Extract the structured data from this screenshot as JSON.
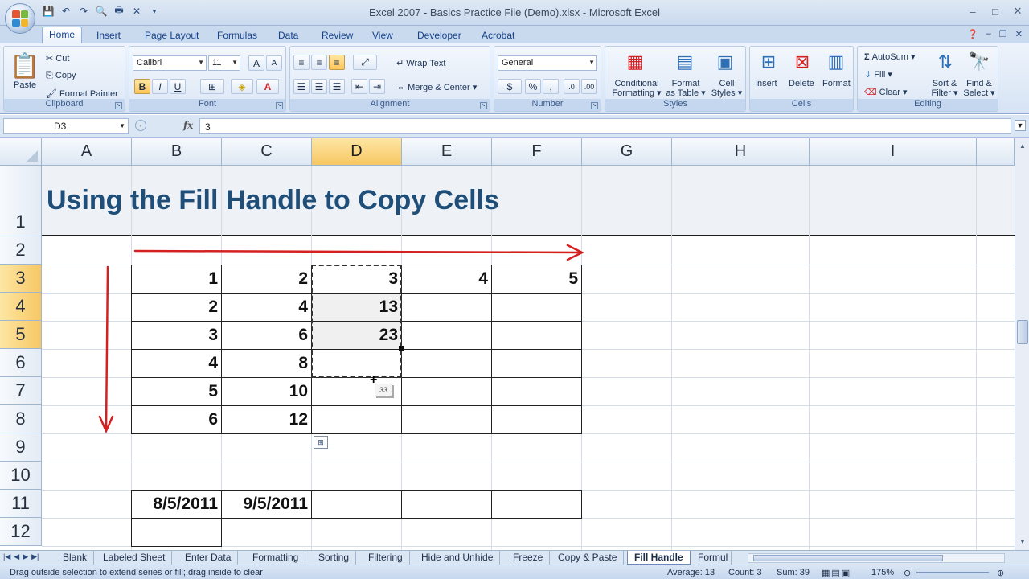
{
  "window": {
    "title": "Excel 2007 - Basics Practice File (Demo).xlsx - Microsoft Excel",
    "controls": [
      "–",
      "□",
      "✕"
    ]
  },
  "qat": [
    "save-icon",
    "undo-icon",
    "redo-icon",
    "print-preview-icon",
    "quick-print-icon",
    "close-icon"
  ],
  "ribbon_tabs": [
    "Home",
    "Insert",
    "Page Layout",
    "Formulas",
    "Data",
    "Review",
    "View",
    "Developer",
    "Acrobat"
  ],
  "ribbon": {
    "clipboard": {
      "label": "Clipboard",
      "paste": "Paste",
      "cut": "Cut",
      "copy": "Copy",
      "format_painter": "Format Painter"
    },
    "font": {
      "label": "Font",
      "font_name": "Calibri",
      "font_size": "11",
      "bold": "B",
      "italic": "I",
      "underline": "U"
    },
    "alignment": {
      "label": "Alignment",
      "wrap_text": "Wrap Text",
      "merge_center": "Merge & Center"
    },
    "number": {
      "label": "Number",
      "format": "General",
      "currency": "$",
      "percent": "%",
      "comma": ","
    },
    "styles": {
      "label": "Styles",
      "conditional": "Conditional",
      "conditional2": "Formatting",
      "format_table": "Format",
      "format_table2": "as Table",
      "cell_styles": "Cell",
      "cell_styles2": "Styles"
    },
    "cells": {
      "label": "Cells",
      "insert": "Insert",
      "delete": "Delete",
      "format": "Format"
    },
    "editing": {
      "label": "Editing",
      "autosum": "AutoSum",
      "fill": "Fill",
      "clear": "Clear",
      "sort": "Sort &",
      "sort2": "Filter",
      "find": "Find &",
      "find2": "Select"
    }
  },
  "formula_bar": {
    "name_box": "D3",
    "fx": "fx",
    "value": "3"
  },
  "columns": [
    "A",
    "B",
    "C",
    "D",
    "E",
    "F",
    "G",
    "H",
    "I"
  ],
  "rows": [
    "1",
    "2",
    "3",
    "4",
    "5",
    "6",
    "7",
    "8",
    "9",
    "10",
    "11",
    "12"
  ],
  "sheet": {
    "title": "Using the Fill Handle to Copy Cells",
    "cells": {
      "B3": "1",
      "C3": "2",
      "D3": "3",
      "E3": "4",
      "F3": "5",
      "B4": "2",
      "C4": "4",
      "D4": "13",
      "B5": "3",
      "C5": "6",
      "D5": "23",
      "B6": "4",
      "C6": "8",
      "B7": "5",
      "C7": "10",
      "B8": "6",
      "C8": "12",
      "B11": "8/5/2011",
      "C11": "9/5/2011"
    },
    "fill_tooltip": "33"
  },
  "sheet_tabs": [
    "Blank",
    "Labeled Sheet",
    "Enter Data",
    "Formatting",
    "Sorting",
    "Filtering",
    "Hide and Unhide",
    "Freeze",
    "Copy & Paste",
    "Fill Handle",
    "Formul"
  ],
  "active_sheet": "Fill Handle",
  "status": {
    "message": "Drag outside selection to extend series or fill; drag inside to clear",
    "average": "Average: 13",
    "count": "Count: 3",
    "sum": "Sum: 39",
    "zoom": "175%"
  },
  "colors": {
    "arrow": "#d42020",
    "title": "#1f4e79",
    "selected_header": "#f7c764"
  }
}
